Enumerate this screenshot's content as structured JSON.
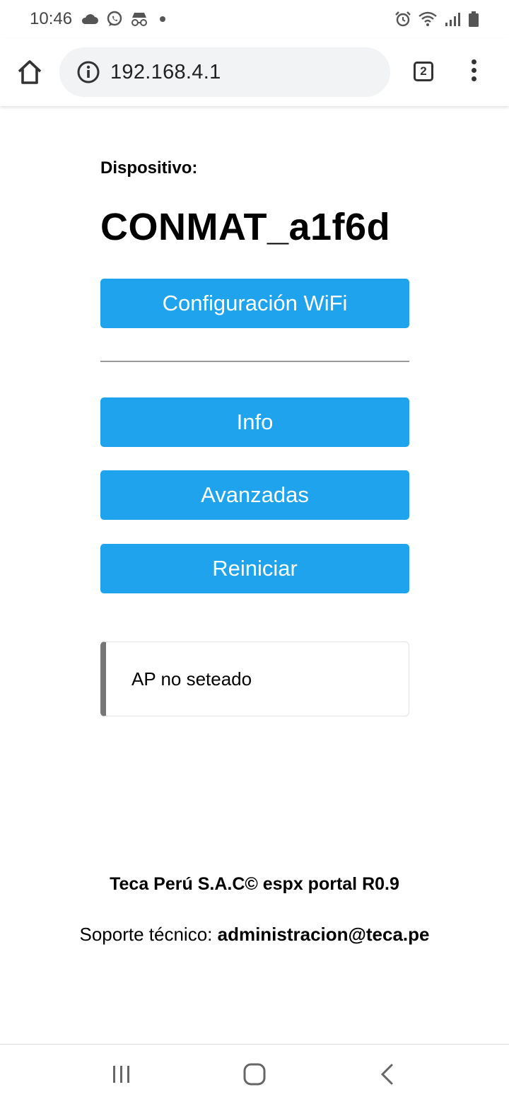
{
  "status_bar": {
    "time": "10:46",
    "left_icons": [
      "cloud-icon",
      "whatsapp-icon",
      "incognito-icon",
      "dot-icon"
    ],
    "right_icons": [
      "alarm-icon",
      "wifi-icon",
      "signal-icon",
      "battery-icon"
    ]
  },
  "browser": {
    "url": "192.168.4.1",
    "tab_count": "2"
  },
  "page": {
    "device_label": "Dispositivo:",
    "device_name": "CONMAT_a1f6d",
    "buttons": {
      "wifi": "Configuración WiFi",
      "info": "Info",
      "advanced": "Avanzadas",
      "restart": "Reiniciar"
    },
    "message": "AP no seteado",
    "button_color": "#1fa3ec"
  },
  "footer": {
    "title": "Teca Perú S.A.C© espx portal R0.9",
    "support_label": "Soporte técnico: ",
    "support_email": "administracion@teca.pe"
  },
  "nav_bar": {
    "icons": [
      "recent-apps-icon",
      "home-nav-icon",
      "back-icon"
    ]
  }
}
